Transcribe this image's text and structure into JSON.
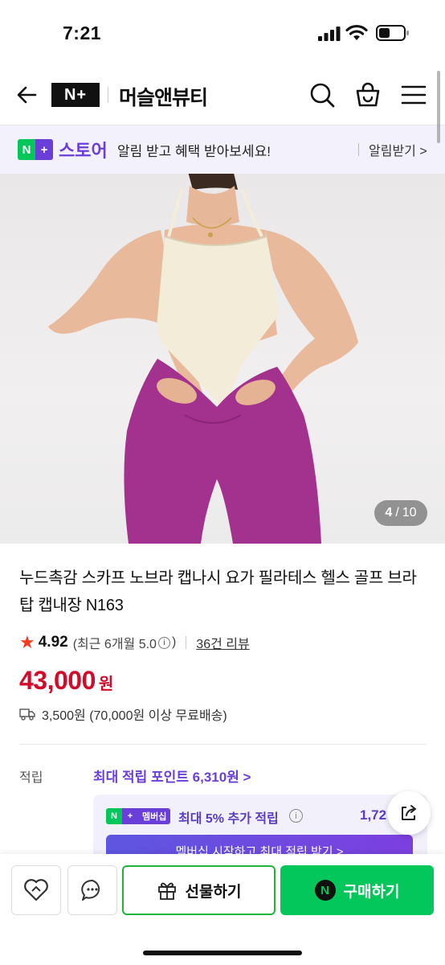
{
  "status_bar": {
    "time": "7:21"
  },
  "header": {
    "logo_text": "N+",
    "store_name": "머슬앤뷰티"
  },
  "banner": {
    "store_label": "스토어",
    "message": "알림 받고 혜택 받아보세요!",
    "action": "알림받기 >"
  },
  "gallery": {
    "current": "4",
    "separator": "/",
    "total": "10"
  },
  "product": {
    "title": "누드촉감 스카프 노브라 캡나시 요가 필라테스 헬스 골프 브라탑 캡내장 N163",
    "rating": "4.92",
    "recent_rating": "(최근 6개월 5.0",
    "recent_rating_close": ")",
    "reviews": "36건 리뷰",
    "price": "43,000",
    "price_unit": "원",
    "shipping": "3,500원 (70,000원 이상 무료배송)"
  },
  "points": {
    "label": "적립",
    "max_points": "최대 적립 포인트 6,310원 >",
    "membership_badge": "멤버십",
    "extra_rate": "최대 5% 추가 적립",
    "extra_amount": "1,72",
    "cta": "멤버십 시작하고 최대 적립 받기 >"
  },
  "bottom_bar": {
    "gift_label": "선물하기",
    "buy_label": "구매하기"
  },
  "colors": {
    "brand_purple": "#6a3fd9",
    "naver_green": "#03c75a",
    "price_red": "#d10b2a",
    "star": "#f23a1f"
  },
  "icons": [
    "back-arrow-icon",
    "search-icon",
    "cart-icon",
    "menu-icon",
    "star-icon",
    "truck-icon",
    "info-icon",
    "share-icon",
    "heart-icon",
    "chat-icon",
    "gift-icon",
    "naver-n-icon"
  ]
}
